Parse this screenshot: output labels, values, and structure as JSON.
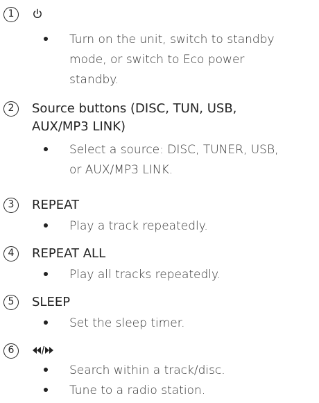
{
  "items": [
    {
      "number": "1",
      "icon": "power-icon",
      "bullets": [
        [
          "Turn on the unit, switch to standby",
          "mode, or switch to Eco power",
          "standby."
        ]
      ]
    },
    {
      "number": "2",
      "title_lines": [
        "Source buttons (DISC, TUN, USB,",
        "AUX/MP3 LINK)"
      ],
      "bullets": [
        [
          "Select a source: DISC, TUNER, USB,",
          "or AUX/MP3 LINK."
        ]
      ]
    },
    {
      "number": "3",
      "title": "REPEAT",
      "bullets": [
        [
          "Play a track repeatedly."
        ]
      ]
    },
    {
      "number": "4",
      "title": "REPEAT ALL",
      "bullets": [
        [
          "Play all tracks repeatedly."
        ]
      ]
    },
    {
      "number": "5",
      "title": "SLEEP",
      "bullets": [
        [
          "Set the sleep timer."
        ]
      ]
    },
    {
      "number": "6",
      "icon": "rewind-forward-icon",
      "bullets": [
        [
          "Search within a track/disc."
        ],
        [
          "Tune to a radio station."
        ]
      ]
    }
  ]
}
